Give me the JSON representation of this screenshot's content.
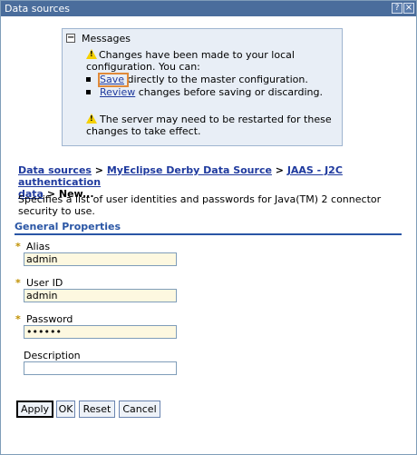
{
  "window": {
    "title": "Data sources",
    "help_glyph": "?",
    "close_glyph": "×"
  },
  "messages": {
    "toggle_glyph": "−",
    "title": "Messages",
    "line1": "Changes have been made to your local",
    "line2": "configuration. You can:",
    "save_link": "Save",
    "save_rest": " directly to the master configuration.",
    "review_link": "Review",
    "review_rest": " changes before saving or discarding.",
    "warn2_line1": "The server may need to be restarted for these",
    "warn2_line2": "changes to take effect."
  },
  "breadcrumb": {
    "item1": "Data sources",
    "sep": " > ",
    "item2": "MyEclipse Derby Data Source",
    "item3_part1": "JAAS - J2C authentication",
    "item3_part2": "data",
    "current": " > New..."
  },
  "description": "Specifies a list of user identities and passwords for Java(TM) 2 connector security to use.",
  "section": {
    "title": "General Properties"
  },
  "form": {
    "required_mark": "*",
    "alias": {
      "label": "Alias",
      "value": "admin"
    },
    "userid": {
      "label": "User ID",
      "value": "admin"
    },
    "password": {
      "label": "Password",
      "value": "admin1"
    },
    "description": {
      "label": "Description",
      "value": ""
    }
  },
  "buttons": {
    "apply": "Apply",
    "ok": "OK",
    "reset": "Reset",
    "cancel": "Cancel"
  },
  "icons": {
    "warning": "warning-icon",
    "collapse": "collapse-icon"
  }
}
